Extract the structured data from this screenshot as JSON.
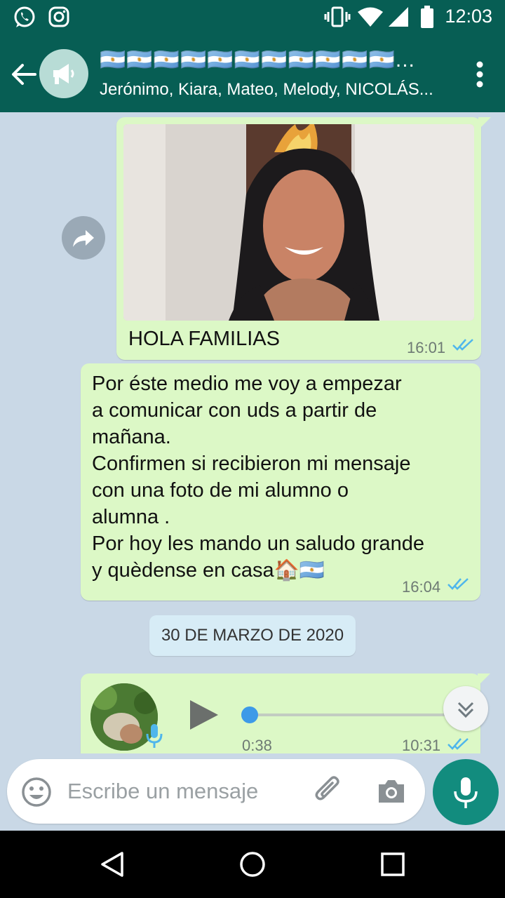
{
  "statusbar": {
    "time": "12:03",
    "icons": [
      "whatsapp-icon",
      "instagram-icon",
      "vibrate-icon",
      "wifi-icon",
      "signal-icon",
      "battery-icon"
    ]
  },
  "header": {
    "title": "🇦🇷🇦🇷🇦🇷🇦🇷🇦🇷🇦🇷🇦🇷🇦🇷🇦🇷🇦🇷🇦🇷...",
    "subtitle": "Jerónimo, Kiara, Mateo, Melody, NICOLÁS...",
    "avatar_icon": "megaphone-icon"
  },
  "messages": [
    {
      "type": "image",
      "caption": "HOLA FAMILIAS",
      "time": "16:01",
      "status": "read"
    },
    {
      "type": "text",
      "lines": [
        "Por éste medio me voy a empezar",
        "a comunicar con uds a partir de",
        "mañana.",
        "Confirmen si recibieron mi mensaje",
        "con una foto de mi alumno o",
        "alumna .",
        "Por hoy les mando un saludo grande",
        "y quèdense en casa🏠🇦🇷"
      ],
      "time": "16:04",
      "status": "read"
    },
    {
      "type": "voice",
      "duration": "0:38",
      "time": "10:31",
      "status": "read",
      "progress": 0
    }
  ],
  "date_chip": "30 DE MARZO DE 2020",
  "composer": {
    "placeholder": "Escribe un mensaje"
  },
  "colors": {
    "header": "#075e54",
    "bubble_out": "#dcf8c6",
    "accent": "#128c7e",
    "ticks": "#4fb6ec",
    "chat_bg": "#c9d8e6"
  }
}
